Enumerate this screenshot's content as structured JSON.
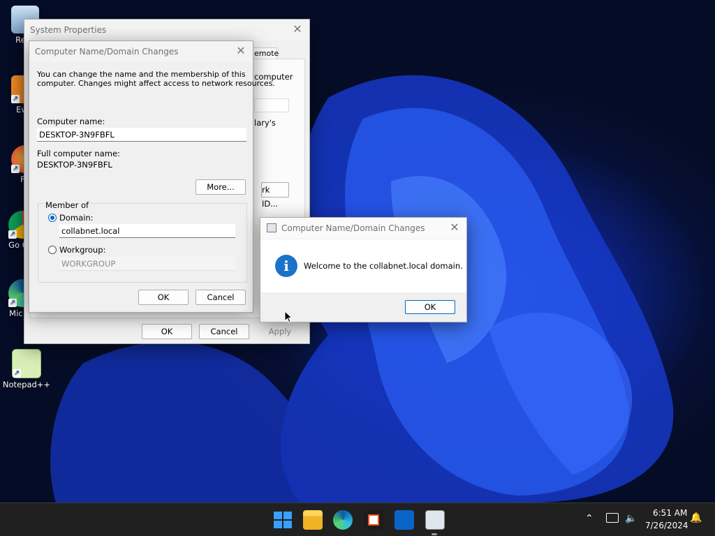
{
  "desktop": {
    "icons": [
      {
        "label": "Recy"
      },
      {
        "label": "Ever"
      },
      {
        "label": "Fir"
      },
      {
        "label": "Go Chr"
      },
      {
        "label": "Mic Ed"
      },
      {
        "label": "Notepad++"
      }
    ]
  },
  "system_properties": {
    "title": "System Properties",
    "tab_partial": "emote",
    "partial_text_1": "computer",
    "partial_text_2": "lary's",
    "partial_button": "rk ID...",
    "ok": "OK",
    "cancel": "Cancel",
    "apply": "Apply"
  },
  "name_dialog": {
    "title": "Computer Name/Domain Changes",
    "intro_line1": "You can change the name and the membership of this",
    "intro_line2": "computer. Changes might affect access to network resources.",
    "computer_name_label": "Computer name:",
    "computer_name_value": "DESKTOP-3N9FBFL",
    "full_name_label": "Full computer name:",
    "full_name_value": "DESKTOP-3N9FBFL",
    "more_button": "More...",
    "member_of_label": "Member of",
    "domain_label": "Domain:",
    "domain_value": "collabnet.local",
    "workgroup_label": "Workgroup:",
    "workgroup_value": "WORKGROUP",
    "ok": "OK",
    "cancel": "Cancel"
  },
  "welcome_dialog": {
    "title": "Computer Name/Domain Changes",
    "message": "Welcome to the collabnet.local domain.",
    "ok": "OK"
  },
  "taskbar": {
    "time": "6:51 AM",
    "date": "7/26/2024"
  },
  "colors": {
    "accent": "#0067c0",
    "taskbar": "#202020"
  }
}
